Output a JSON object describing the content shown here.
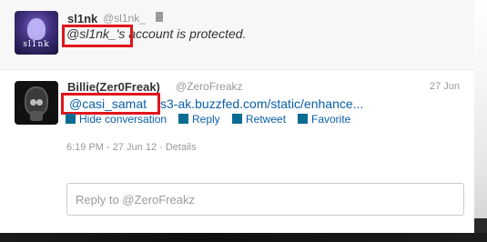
{
  "tweets": [
    {
      "name": "sl1nk",
      "handle": "@sl1nk_",
      "lock_icon": "lock-icon",
      "text": "@sl1nk_'s account is protected.",
      "highlight_text": "@sl1nk_'s"
    },
    {
      "name": "Billie(Zer0Freak)",
      "handle": "@ZeroFreakz",
      "time": "27 Jun",
      "mention": "@casi_samat",
      "link": "s3-ak.buzzfed.com/static/enhance...",
      "actions": [
        {
          "label": "Hide conversation",
          "icon": "collapse-icon"
        },
        {
          "label": "Reply",
          "icon": "reply-icon"
        },
        {
          "label": "Retweet",
          "icon": "retweet-icon"
        },
        {
          "label": "Favorite",
          "icon": "favorite-icon"
        }
      ],
      "meta": "6:19 PM - 27 Jun 12 · Details"
    }
  ],
  "reply": {
    "placeholder": "Reply to @ZeroFreakz"
  },
  "colors": {
    "link": "#0b5fa8",
    "highlight_border": "#e0151c",
    "action_icon": "#0b6c94"
  }
}
